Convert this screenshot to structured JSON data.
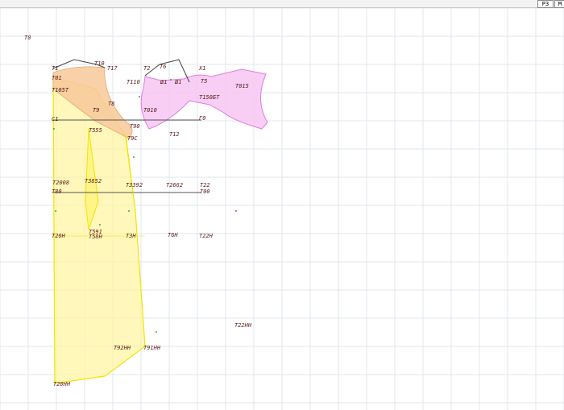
{
  "toolbar": {
    "button_a": "Р3",
    "button_b": "М"
  },
  "colors": {
    "grid": "#e1e7ee",
    "background": "#ffffff",
    "front_piece": "#fff59d",
    "front_edge": "#f2e400",
    "back_armhole": "#f7c99a",
    "sleeve_piece": "#f7c6f2",
    "sleeve_edge": "#df7ce0",
    "outline": "#444444",
    "label": "#5a1a1a"
  },
  "labels": {
    "t0": "Т0",
    "t1": "Т1",
    "t10": "Т10",
    "t17": "Т17",
    "t2": "Т2",
    "t6": "Т6",
    "x1": "Х1",
    "t01": "Т01",
    "t110": "Т110",
    "u1a": "Ш1",
    "u1b": "Ш1",
    "t5": "Т5",
    "t015": "Т015",
    "t105t": "Т105Т",
    "t8": "Т8",
    "t150bt": "Т150БТ",
    "t9": "Т9",
    "t010": "Т010",
    "c1": "С1",
    "g0": "Г0",
    "t555": "Т555",
    "t90": "Т90",
    "t9c": "Т9С",
    "t12": "Т12",
    "t2008": "Т2008",
    "t3852": "Т3852",
    "t3392": "Т3392",
    "t2662": "Т2662",
    "t22": "Т22",
    "t80": "Т80",
    "t00": "Т00",
    "t591": "Т591",
    "t20h": "Т20Н",
    "t58h": "Т58Н",
    "t3h": "Т3Н",
    "t6h": "Т6Н",
    "t22h": "Т22Н",
    "t22hh": "Т22НН",
    "t92hh": "Т92НН",
    "t91hh": "Т91НН",
    "t20hh": "Т20НН"
  }
}
